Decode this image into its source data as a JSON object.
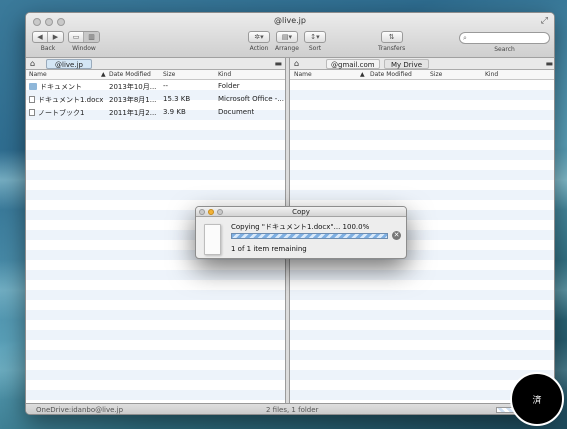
{
  "window": {
    "title": "@live.jp"
  },
  "toolbar": {
    "back_label": "Back",
    "window_label": "Window",
    "action_label": "Action",
    "arrange_label": "Arrange",
    "sort_label": "Sort",
    "transfers_label": "Transfers",
    "search_label": "Search",
    "search_placeholder": ""
  },
  "left_pane": {
    "account": "@live.jp",
    "columns": {
      "name": "Name",
      "date": "Date Modified",
      "size": "Size",
      "kind": "Kind"
    },
    "rows": [
      {
        "icon": "folder-icon",
        "name": "ドキュメント",
        "date": "2013年10月...",
        "size": "--",
        "kind": "Folder"
      },
      {
        "icon": "document-icon",
        "name": "ドキュメント1.docx",
        "date": "2013年8月1...",
        "size": "15.3 KB",
        "kind": "Microsoft Office -..."
      },
      {
        "icon": "document-icon",
        "name": "ノートブック1",
        "date": "2011年1月2...",
        "size": "3.9 KB",
        "kind": "Document"
      }
    ]
  },
  "right_pane": {
    "account": "@gmail.com",
    "tab": "My Drive",
    "columns": {
      "name": "Name",
      "date": "Date Modified",
      "size": "Size",
      "kind": "Kind"
    }
  },
  "statusbar": {
    "account": "OneDrive:idanbo@live.jp",
    "summary": "2 files, 1 folder",
    "progress": 1.0
  },
  "copy_dialog": {
    "title": "Copy",
    "message": "Copying \"ドキュメント1.docx\"... 100.0%",
    "progress": 1.0,
    "remaining": "1 of 1 item remaining"
  },
  "watermark": {
    "text": "済"
  }
}
